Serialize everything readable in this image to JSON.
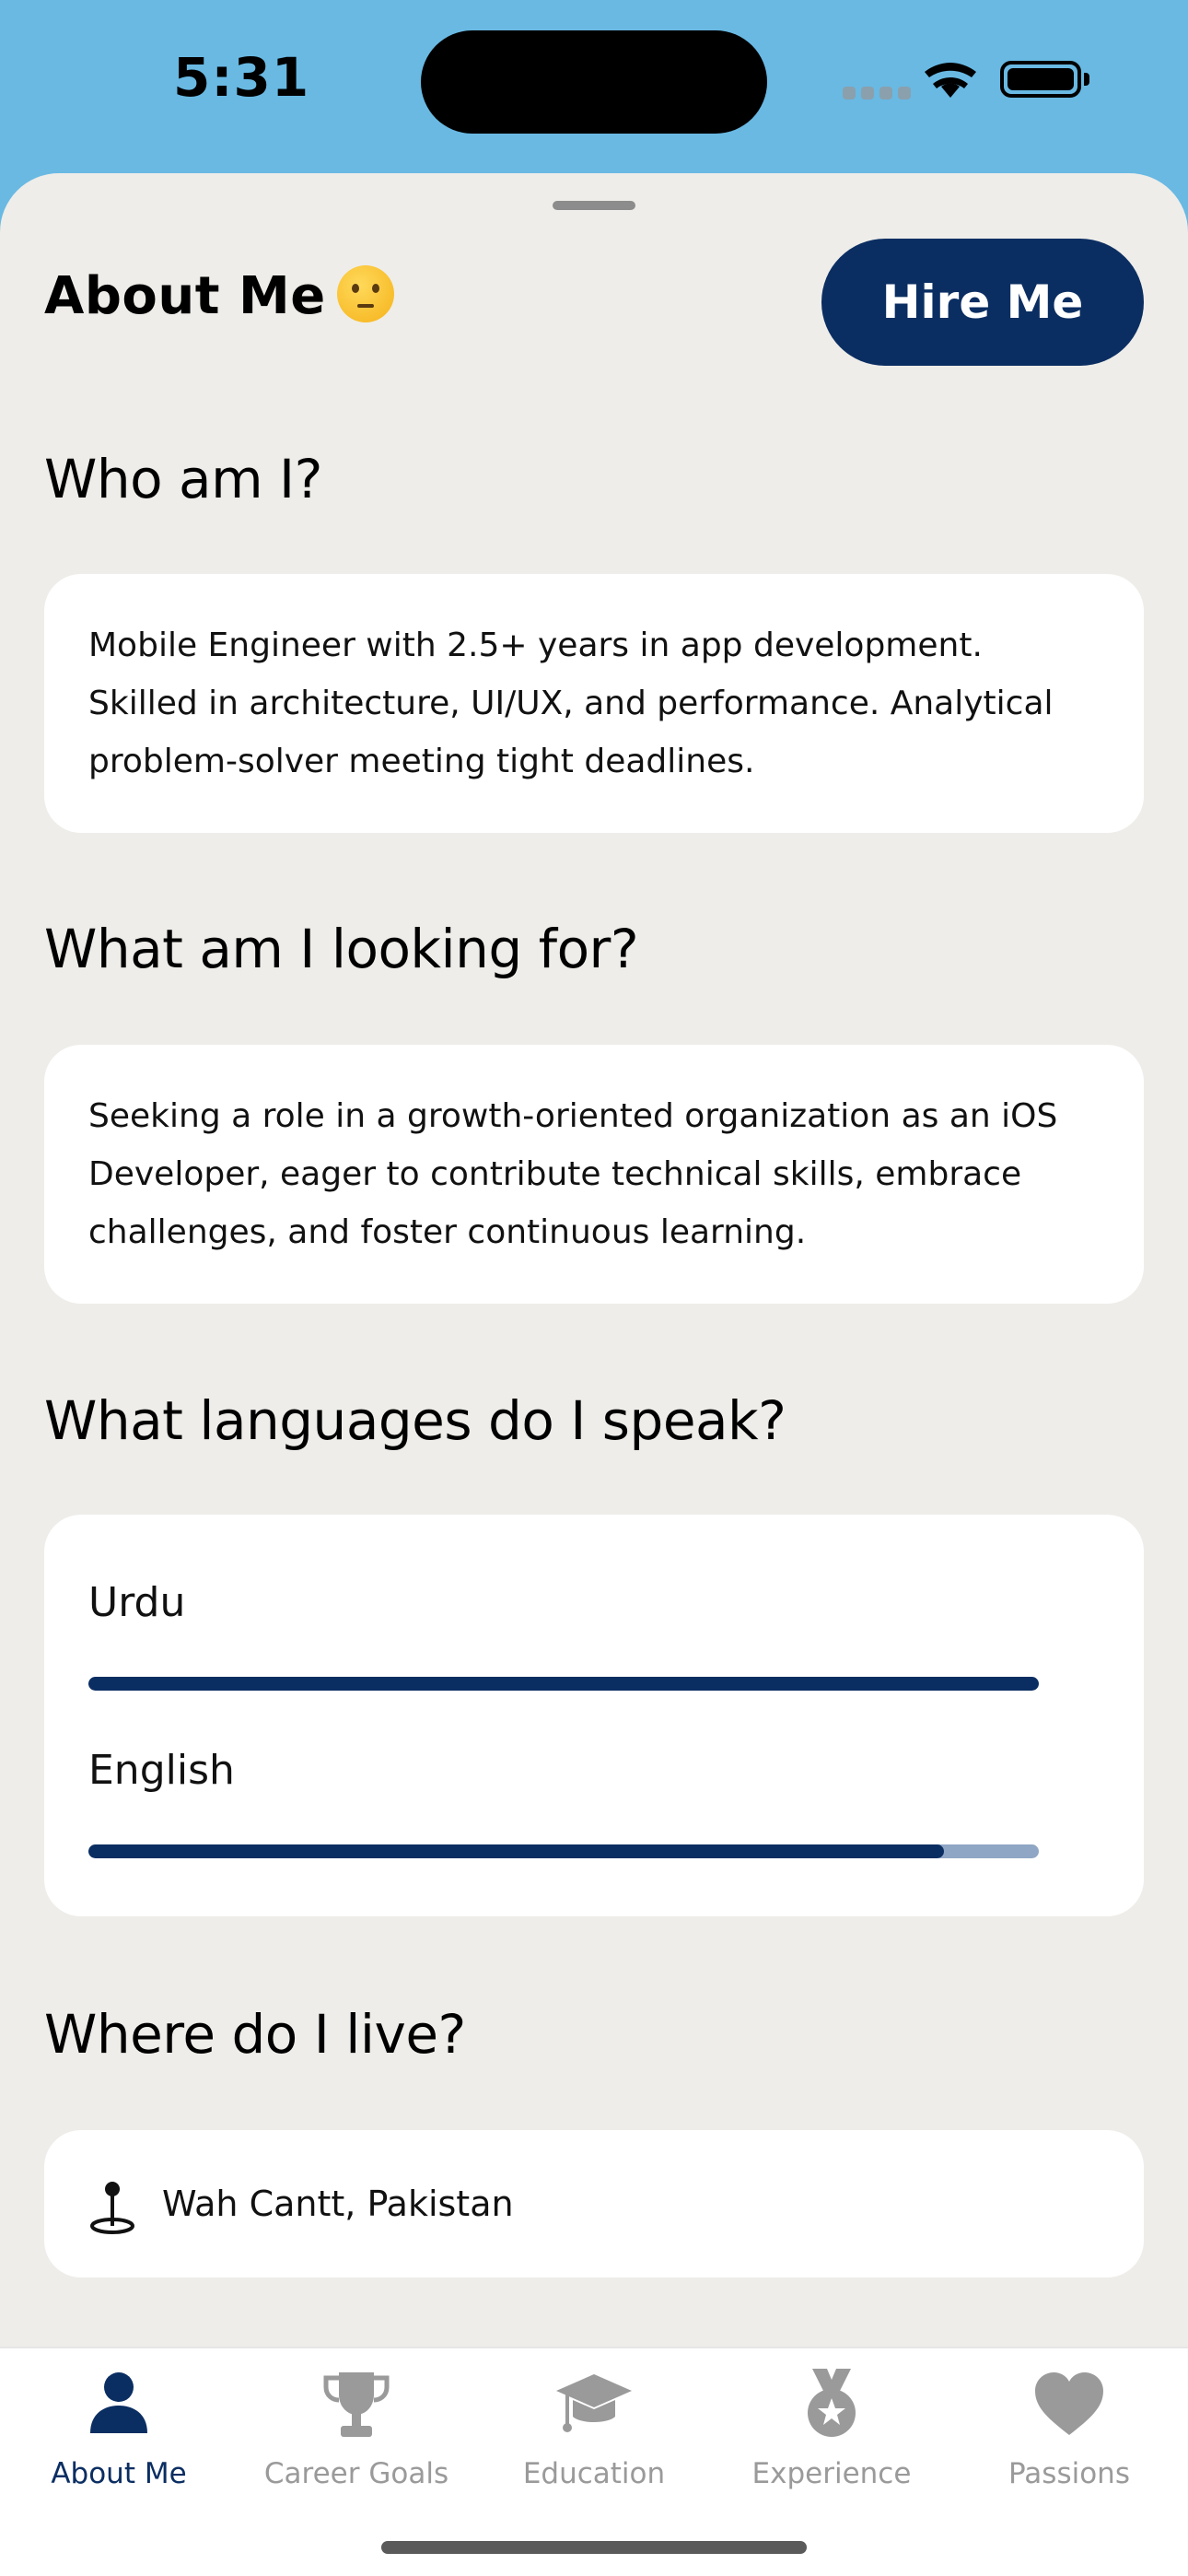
{
  "status_bar": {
    "time": "5:31"
  },
  "header": {
    "title": "About Me",
    "emoji_icon": "thinking-face-emoji",
    "hire_button": "Hire Me"
  },
  "sections": {
    "who": {
      "heading": "Who am I?",
      "text": "Mobile Engineer with 2.5+ years in app development. Skilled in architecture, UI/UX, and performance. Analytical problem-solver meeting tight deadlines."
    },
    "looking": {
      "heading": "What am I looking for?",
      "text": "Seeking a role in a growth-oriented organization as an iOS Developer, eager to contribute technical skills, embrace challenges, and foster continuous learning."
    },
    "languages": {
      "heading": "What languages do I speak?",
      "items": [
        {
          "name": "Urdu",
          "level": 1.0
        },
        {
          "name": "English",
          "level": 0.9
        }
      ]
    },
    "location": {
      "heading": "Where do I live?",
      "icon": "map-pin-icon",
      "text": "Wah Cantt, Pakistan"
    }
  },
  "tabs": [
    {
      "label": "About Me",
      "icon": "person-icon",
      "active": true
    },
    {
      "label": "Career Goals",
      "icon": "trophy-icon",
      "active": false
    },
    {
      "label": "Education",
      "icon": "graduation-cap-icon",
      "active": false
    },
    {
      "label": "Experience",
      "icon": "medal-icon",
      "active": false
    },
    {
      "label": "Passions",
      "icon": "heart-icon",
      "active": false
    }
  ],
  "colors": {
    "accent": "#0b2e62",
    "sheet_bg": "#eeede9",
    "top_bg": "#69b9e3",
    "inactive_tab": "#9a9a9a"
  }
}
